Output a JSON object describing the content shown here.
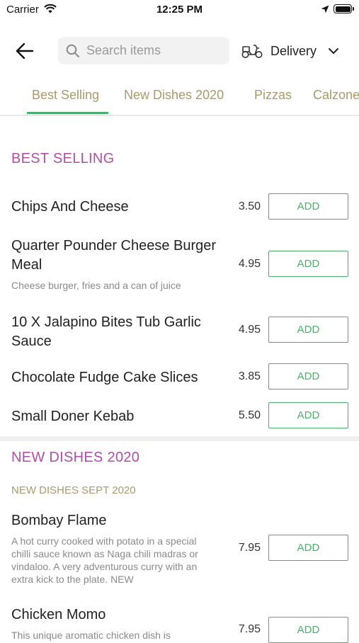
{
  "status_bar": {
    "carrier": "Carrier",
    "time": "12:25 PM"
  },
  "header": {
    "search_placeholder": "Search items",
    "delivery_label": "Delivery"
  },
  "tabs": [
    {
      "label": "Best Selling",
      "active": true
    },
    {
      "label": "New Dishes 2020"
    },
    {
      "label": "Pizzas"
    },
    {
      "label": "Calzone"
    }
  ],
  "sections": [
    {
      "title": "BEST SELLING",
      "items": [
        {
          "name": "Chips And Cheese",
          "price": "3.50",
          "add": "ADD"
        },
        {
          "name": "Quarter Pounder Cheese Burger Meal",
          "description": "Cheese burger, fries and a can of juice",
          "price": "4.95",
          "add": "ADD"
        },
        {
          "name": "10 X Jalapino Bites Tub Garlic Sauce",
          "price": "4.95",
          "add": "ADD"
        },
        {
          "name": "Chocolate Fudge Cake Slices",
          "price": "3.85",
          "add": "ADD"
        },
        {
          "name": "Small Doner Kebab",
          "price": "5.50",
          "add": "ADD"
        }
      ]
    },
    {
      "title": "NEW DISHES 2020",
      "subtitle": "NEW DISHES SEPT 2020",
      "items": [
        {
          "name": "Bombay Flame",
          "description": "A hot curry cooked with potato in a special chilli sauce known as Naga chili madras or vindaloo. A very adventurous curry with an extra kick to the plate. NEW",
          "price": "7.95",
          "add": "ADD"
        },
        {
          "name": "Chicken Momo",
          "description": "This unique aromatic chicken dish is",
          "price": "7.95",
          "add": "ADD"
        }
      ]
    }
  ],
  "colors": {
    "accent_green": "#4cae6a",
    "section_purple": "#b04fa8",
    "tab_gold": "#a89a6a"
  }
}
